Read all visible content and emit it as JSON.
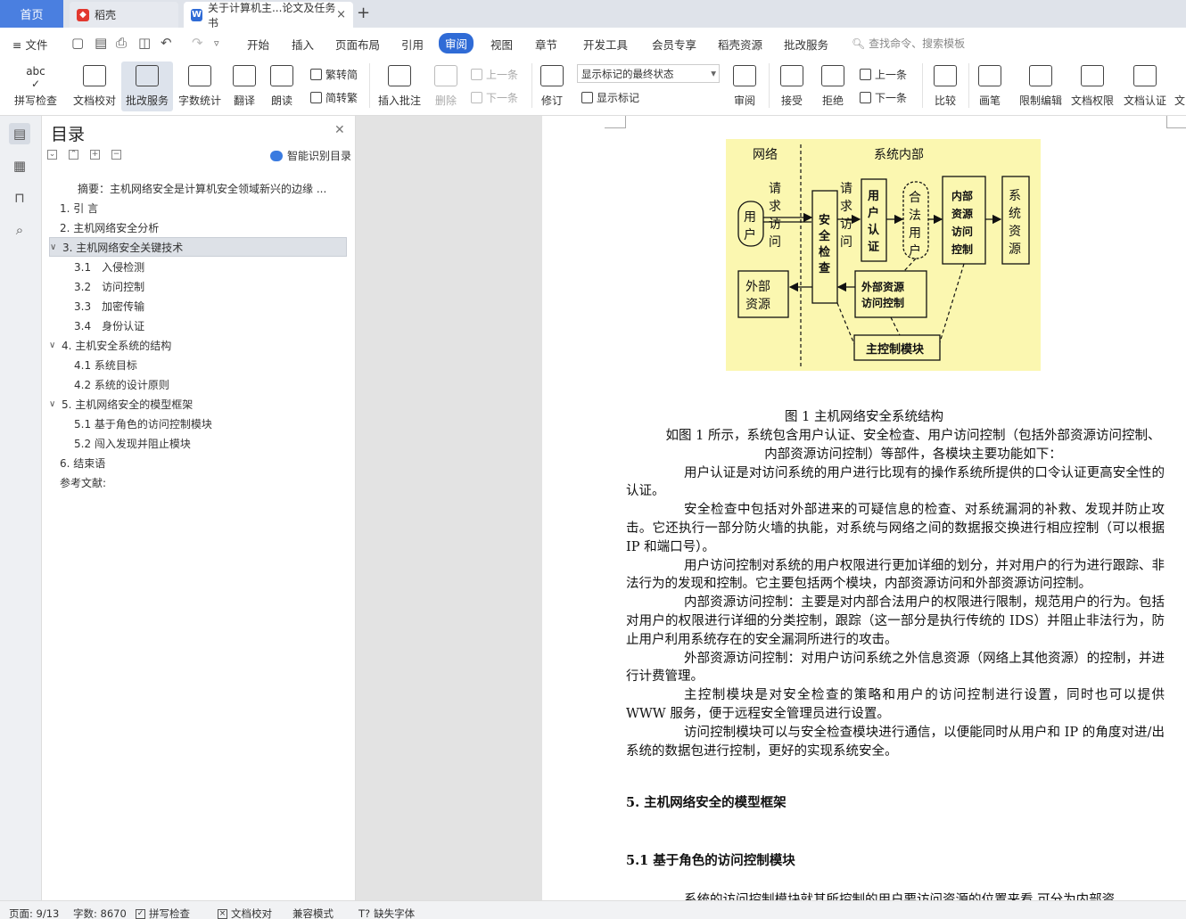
{
  "tabs": {
    "home": "首页",
    "t1": "稻壳",
    "t2": "关于计算机主...论文及任务书"
  },
  "menu": {
    "file": "文件",
    "items": [
      "开始",
      "插入",
      "页面布局",
      "引用",
      "审阅",
      "视图",
      "章节",
      "开发工具",
      "会员专享",
      "稻壳资源",
      "批改服务"
    ],
    "active_index": 4,
    "search": "查找命令、搜索模板"
  },
  "ribbon": {
    "spell": "拼写检查",
    "proof": "文档校对",
    "correct": "批改服务",
    "wordcount": "字数统计",
    "translate": "翻译",
    "read": "朗读",
    "trad": "繁转简",
    "simp": "简转繁",
    "insert_comment": "插入批注",
    "delete": "删除",
    "prev_comment": "上一条",
    "next_comment": "下一条",
    "revise": "修订",
    "markup_state": "显示标记的最终状态",
    "show_markup": "显示标记",
    "review": "审阅",
    "accept": "接受",
    "reject": "拒绝",
    "prev": "上一条",
    "next": "下一条",
    "compare": "比较",
    "pen": "画笔",
    "restrict": "限制编辑",
    "rights": "文档权限",
    "cert": "文档认证",
    "more": "文"
  },
  "toc": {
    "title": "目录",
    "ai": "智能识别目录",
    "items": [
      {
        "label": "摘要：主机网络安全是计算机安全领域新兴的边缘 ...",
        "level": 0,
        "chev": ""
      },
      {
        "label": "1. 引 言",
        "level": 1,
        "chev": ""
      },
      {
        "label": "2. 主机网络安全分析",
        "level": 1,
        "chev": ""
      },
      {
        "label": "3. 主机网络安全关键技术",
        "level": 1,
        "chev": "∨"
      },
      {
        "label": "3.1　入侵检测",
        "level": 2,
        "chev": ""
      },
      {
        "label": "3.2　访问控制",
        "level": 2,
        "chev": ""
      },
      {
        "label": "3.3　加密传输",
        "level": 2,
        "chev": ""
      },
      {
        "label": "3.4　身份认证",
        "level": 2,
        "chev": ""
      },
      {
        "label": "4. 主机安全系统的结构",
        "level": 1,
        "chev": "∨"
      },
      {
        "label": "4.1 系统目标",
        "level": 2,
        "chev": ""
      },
      {
        "label": "4.2 系统的设计原则",
        "level": 2,
        "chev": ""
      },
      {
        "label": "5. 主机网络安全的模型框架",
        "level": 1,
        "chev": "∨"
      },
      {
        "label": "5.1 基于角色的访问控制模块",
        "level": 2,
        "chev": ""
      },
      {
        "label": "5.2 闯入发现并阻止模块",
        "level": 2,
        "chev": ""
      },
      {
        "label": "6. 结束语",
        "level": 1,
        "chev": ""
      },
      {
        "label": "参考文献:",
        "level": 0,
        "chev": ""
      }
    ],
    "selected_index": 3
  },
  "figure": {
    "net": "网络",
    "inner": "系统内部",
    "request1": "请求访问",
    "user": "用户",
    "security": "安全检查",
    "request2": "请求访问",
    "auth": "用户认证",
    "legal": "合法用户",
    "inner_ctrl": "内部资源访问控制",
    "sysres": "系统资源",
    "ext": "外部资源",
    "ext_ctrl1": "外部资源",
    "ext_ctrl2": "访问控制",
    "main": "主控制模块"
  },
  "doc": {
    "caption": "图 1  主机网络安全系统结构",
    "p1": "如图 1 所示，系统包含用户认证、安全检查、用户访问控制（包括外部资源访问控制、内部资源访问控制）等部件，各模块主要功能如下：",
    "p2": "用户认证是对访问系统的用户进行比现有的操作系统所提供的口令认证更高安全性的认证。",
    "p3": "安全检查中包括对外部进来的可疑信息的检查、对系统漏洞的补救、发现并防止攻击。它还执行一部分防火墙的执能，对系统与网络之间的数据报交换进行相应控制（可以根据 IP 和端口号）。",
    "p4": "用户访问控制对系统的用户权限进行更加详细的划分，并对用户的行为进行跟踪、非法行为的发现和控制。它主要包括两个模块，内部资源访问和外部资源访问控制。",
    "p5": "内部资源访问控制：主要是对内部合法用户的权限进行限制，规范用户的行为。包括对用户的权限进行详细的分类控制，跟踪（这一部分是执行传统的 IDS）并阻止非法行为，防止用户利用系统存在的安全漏洞所进行的攻击。",
    "p6": "外部资源访问控制：对用户访问系统之外信息资源（网络上其他资源）的控制，并进行计费管理。",
    "p7": "主控制模块是对安全检查的策略和用户的访问控制进行设置，同时也可以提供 WWW 服务，便于远程安全管理员进行设置。",
    "p8": "访问控制模块可以与安全检查模块进行通信，以便能同时从用户和 IP 的角度对进/出系统的数据包进行控制，更好的实现系统安全。",
    "h5": "5.  主机网络安全的模型框架",
    "h51": "5.1  基于角色的访问控制模块",
    "tail": "系统的访问控制模块就其所控制的用户要访问资源的位置来看,可分为内部资"
  },
  "status": {
    "page": "页面: 9/13",
    "words": "字数: 8670",
    "spell": "拼写检查",
    "proof": "文档校对",
    "compat": "兼容模式",
    "missing": "缺失字体"
  }
}
